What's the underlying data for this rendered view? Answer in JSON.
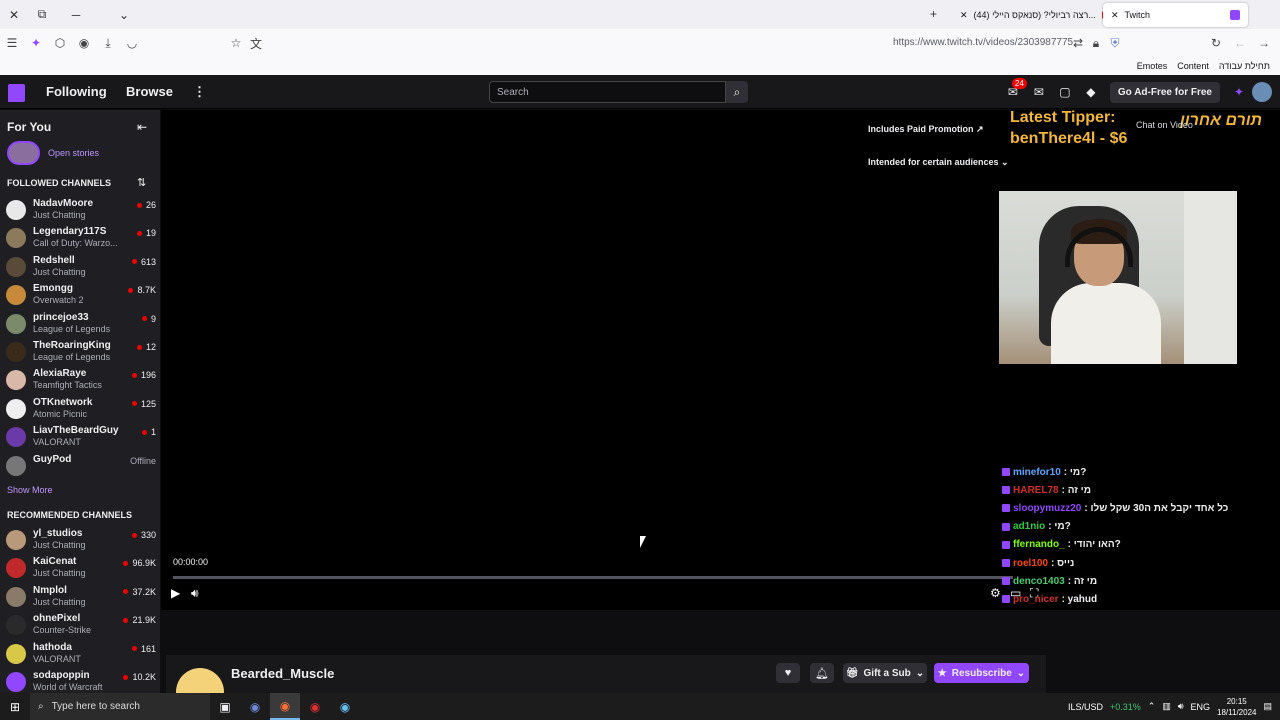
{
  "browser": {
    "tabs": [
      {
        "title": "(44) רצה רביולי? (סנאקס היילי..."
      },
      {
        "title": "Twitch"
      }
    ],
    "url": "https://www.twitch.tv/videos/2303987775",
    "bookmarks": [
      "Emotes",
      "Content",
      "תחילת עבודה"
    ]
  },
  "twitch": {
    "nav": {
      "following": "Following",
      "browse": "Browse",
      "search_placeholder": "Search",
      "notif_count": "24",
      "adfree": "Go Ad-Free for Free"
    },
    "sidebar": {
      "title": "For You",
      "stories": "Open stories",
      "followed_title": "FOLLOWED CHANNELS",
      "followed": [
        {
          "name": "NadavMoore",
          "game": "Just Chatting",
          "viewers": "26",
          "color": "#e8e8e8"
        },
        {
          "name": "Legendary117S",
          "game": "Call of Duty: Warzo...",
          "viewers": "19",
          "color": "#8b7a5c"
        },
        {
          "name": "Redshell",
          "game": "Just Chatting",
          "viewers": "613",
          "color": "#5a4a3a"
        },
        {
          "name": "Emongg",
          "game": "Overwatch 2",
          "viewers": "8.7K",
          "color": "#c68a3a"
        },
        {
          "name": "princejoe33",
          "game": "League of Legends",
          "viewers": "9",
          "color": "#7a8a6a"
        },
        {
          "name": "TheRoaringKing",
          "game": "League of Legends",
          "viewers": "12",
          "color": "#3a2a1a"
        },
        {
          "name": "AlexiaRaye",
          "game": "Teamfight Tactics",
          "viewers": "196",
          "color": "#d8b8a8"
        },
        {
          "name": "OTKnetwork",
          "game": "Atomic Picnic",
          "viewers": "125",
          "color": "#efefef"
        },
        {
          "name": "LiavTheBeardGuy",
          "game": "VALORANT",
          "viewers": "1",
          "color": "#6a3aa8"
        },
        {
          "name": "GuyPod",
          "game": "",
          "viewers": "Offline",
          "color": "#777777"
        }
      ],
      "show_more": "Show More",
      "recommended_title": "RECOMMENDED CHANNELS",
      "recommended": [
        {
          "name": "yl_studios",
          "game": "Just Chatting",
          "viewers": "330",
          "color": "#b89a7a"
        },
        {
          "name": "KaiCenat",
          "game": "Just Chatting",
          "viewers": "96.9K",
          "color": "#c02a2a"
        },
        {
          "name": "Nmplol",
          "game": "Just Chatting",
          "viewers": "37.2K",
          "color": "#8a7a6a"
        },
        {
          "name": "ohnePixel",
          "game": "Counter-Strike",
          "viewers": "21.9K",
          "color": "#2a2a2a"
        },
        {
          "name": "hathoda",
          "game": "VALORANT",
          "viewers": "161",
          "color": "#d8c84a"
        },
        {
          "name": "sodapoppin",
          "game": "World of Warcraft",
          "viewers": "10.2K",
          "color": "#9146ff"
        }
      ]
    },
    "player": {
      "paid_promo": "Includes Paid Promotion",
      "audience": "Intended for certain audiences",
      "time": "00:00:00",
      "progress": 0.0
    },
    "overlay": {
      "tipper": "Latest Tipper:",
      "tipper_value": "benThere4l - $6",
      "hebrew": "תורם אחרון",
      "chat_on_video": "Chat on Video"
    },
    "chat": [
      {
        "user": "minefor10",
        "text": ": מי?",
        "color": "#5ba8ff"
      },
      {
        "user": "HAREL78",
        "text": ": מי זה",
        "color": "#d42b2b"
      },
      {
        "user": "sloopymuzz20",
        "text": ": כל אחד יקבל את ה30 שקל שלו",
        "color": "#9146ff"
      },
      {
        "user": "ad1nio",
        "text": ": מי?",
        "color": "#2ecc40"
      },
      {
        "user": "ffernando_",
        "text": ": האו יהודי?",
        "color": "#7fff00"
      },
      {
        "user": "roel100",
        "text": ": נייס",
        "color": "#ff4500"
      },
      {
        "user": "denco1403",
        "text": ": מי זה",
        "color": "#4ccc70"
      },
      {
        "user": "pro_nicer",
        "text": ": yahud",
        "color": "#d42b2b"
      }
    ],
    "channel": {
      "name": "Bearded_Muscle",
      "gift": "Gift a Sub",
      "resub": "Resubscribe"
    }
  },
  "taskbar": {
    "search": "Type here to search",
    "currency": "ILS/USD",
    "change": "+0.31%",
    "lang": "ENG",
    "time": "20:15",
    "date": "18/11/2024"
  }
}
